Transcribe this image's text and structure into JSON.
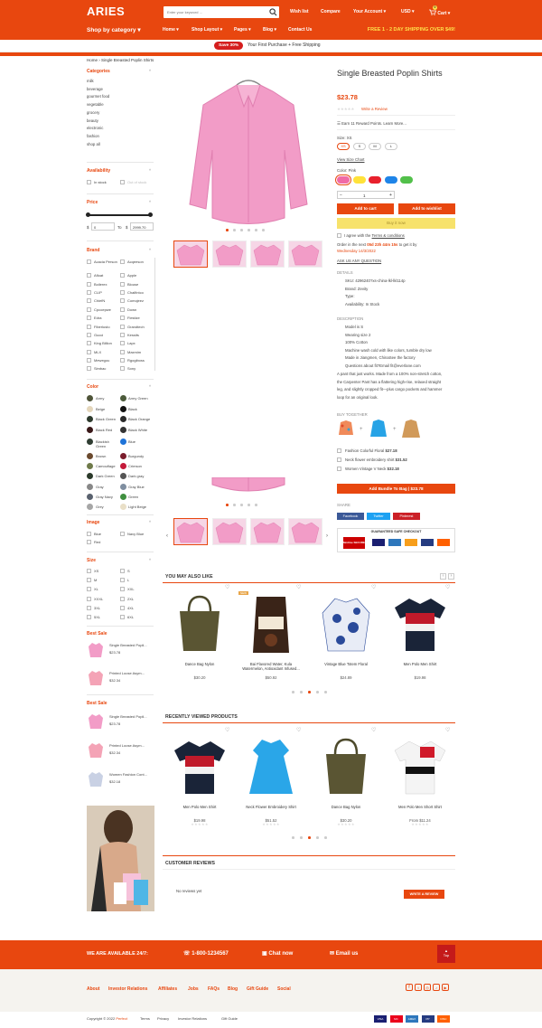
{
  "header": {
    "logo": "ARIES",
    "search_placeholder": "Enter your keyword ...",
    "wishlist": "Wish list",
    "compare": "Compare",
    "account": "Your Account",
    "currency": "USD",
    "cart": "Cart",
    "cart_count": "0",
    "shop_by_category": "Shop by category",
    "nav": [
      "Home",
      "Shop Layout",
      "Pages",
      "Blog",
      "Contact Us"
    ],
    "shipping": "FREE 1 - 2 DAY SHIPPING OVER $49!"
  },
  "promo": {
    "badge": "Save 30%",
    "text": "Your First Purchase + Free Shipping"
  },
  "breadcrumb": {
    "home": "Home",
    "current": "Single Breasted Poplin Shirts"
  },
  "sidebar": {
    "categories_title": "Categories",
    "categories": [
      "milk",
      "beverage",
      "gourmet food",
      "vegetable",
      "grocery",
      "beauty",
      "electronic",
      "fashion",
      "shop all"
    ],
    "availability_title": "Availability",
    "availability": [
      "In stock",
      "Out of stock"
    ],
    "price_title": "Price",
    "price_currency": "$",
    "price_min": "0",
    "price_to": "To",
    "price_max": "2999.70",
    "brand_title": "Brand",
    "brands_left": [
      "Acacia Person",
      "Afloat",
      "Boilerex",
      "CLIP",
      "ChiefN",
      "Cpcoepwe",
      "Edra",
      "Fiberlusto",
      "Gucci",
      "King Billion",
      "MLX",
      "Mewegou",
      "Simbac"
    ],
    "brands_right": [
      "Acqeeson",
      "Apple",
      "Blouse",
      "Chalfintco",
      "Comojeez",
      "Down",
      "Fiestize",
      "Grandtech",
      "Kessits",
      "Lapx",
      "Maxmim",
      "Rgogiboss",
      "Sony"
    ],
    "color_title": "Color",
    "colors_left": [
      "Army",
      "Beige",
      "Black Green",
      "Black Red",
      "Blackish Green",
      "Brown",
      "Camouflage",
      "Dark Green",
      "Gray",
      "Gray Navy",
      "Grey"
    ],
    "colors_right": [
      "Army Green",
      "Black",
      "Black Orange",
      "Black White",
      "Blue",
      "Burgundy",
      "Crimson",
      "Dark gray",
      "Gray Blue",
      "Green",
      "Light Beige"
    ],
    "image_title": "Image",
    "image_opts": [
      "Blue",
      "Navy Blue",
      "Red"
    ],
    "size_title": "Size",
    "sizes_left": [
      "XS",
      "M",
      "XL",
      "XXXL",
      "3XL",
      "5XL"
    ],
    "sizes_right": [
      "S",
      "L",
      "XXL",
      "2XL",
      "4XL",
      "6XL"
    ],
    "best_sale_title": "Best Sale",
    "best_sale": [
      {
        "name": "Single Breasted Popli...",
        "price": "$23.78"
      },
      {
        "name": "Printed Loose Asym...",
        "price": "$32.34"
      }
    ],
    "best_sale2_title": "Best Sale",
    "best_sale2": [
      {
        "name": "Single Breasted Popli...",
        "price": "$23.78"
      },
      {
        "name": "Printed Loose Asym...",
        "price": "$32.34"
      },
      {
        "name": "Women Fashion Cont...",
        "price": "$32.18"
      }
    ]
  },
  "product": {
    "title": "Single Breasted Poplin Shirts",
    "price": "$23.78",
    "write_review": "Write a Review",
    "reward": "Earn 11 Reward Points.",
    "learn_more": "Learn More...",
    "size_label": "Size: XS",
    "sizes": [
      "XS",
      "S",
      "M",
      "L"
    ],
    "size_chart": "View Size Chart",
    "color_label": "Color: Pink",
    "colors_hex": [
      "#f06aa6",
      "#ffe23a",
      "#e8202c",
      "#1e84e8",
      "#52c04a"
    ],
    "qty": "1",
    "add_to_cart": "Add to cart",
    "add_to_wishlist": "Add to wishlist",
    "buy_now": "Buy it now",
    "agree": "I agree with the",
    "terms": "Terms & conditions",
    "order_line1": "Order in the next",
    "order_time": "05d 23h 44m 15s",
    "order_to_get": "to get it by",
    "order_date": "Wednesday 14/3/2022",
    "ask": "ASK US ANY QUESTION",
    "details_title": "DETAILS",
    "details": [
      "SKU: 4296240?xs-china-lkl-lkl114p",
      "Brand: Zevity",
      "Type:",
      "Availability: In Stock"
    ],
    "description_title": "DESCRIPTION",
    "description": [
      "Model is S",
      "Wearing size 2",
      "100% Cotton",
      "Machine wash cold with like colors, tumble dry low",
      "Made in Jiangmen, ChinaSee the factory",
      "Questions about fit?Email fit@everlane.com"
    ],
    "paragraph": [
      "A pant that just works. Made from a 100% non-stretch cotton,",
      "the Carpenter Pant has a flattering high-rise, relaxed straight",
      "leg, and slightly cropped fit—plus cargo pockets and hammer",
      "loop for an original look."
    ],
    "buy_together_title": "BUY TOGETHER",
    "bundle": [
      {
        "name": "Fashion Colorful Floral",
        "price": "$27.18"
      },
      {
        "name": "Neck flower embroidery shirt",
        "price": "$31.52"
      },
      {
        "name": "Women Vintage V Neck",
        "price": "$32.18"
      }
    ],
    "bundle_btn": "Add Bundle To Bag | $23.78",
    "share_title": "SHARE",
    "share": [
      "Facebook",
      "Twitter",
      "Pinterest"
    ],
    "guarantee": "GUARANTEED SAFE CHECKOUT",
    "mcafee": "McAfee SECURE"
  },
  "also_like": {
    "title": "YOU MAY ALSO LIKE",
    "items": [
      {
        "name": "Dance Bag Nylon",
        "price": "$30.20"
      },
      {
        "name": "Bai Flavored Water, Kula Watermelon, Antioxidant Infused...",
        "price": "$50.92",
        "badge": "NEW"
      },
      {
        "name": "Vintage Blue Totem Floral",
        "price": "$24.89"
      },
      {
        "name": "Men Polo Men Shirt",
        "price": "$19.98"
      }
    ]
  },
  "recent": {
    "title": "RECENTLY VIEWED PRODUCTS",
    "items": [
      {
        "name": "Men Polo Men Shirt",
        "price": "$19.98"
      },
      {
        "name": "Neck Flower Embroidery Shirt",
        "price": "$51.52"
      },
      {
        "name": "Dance Bag Nylon",
        "price": "$30.20"
      },
      {
        "name": "Men Polo Men Short Shirt",
        "price": "From $11.24"
      }
    ]
  },
  "reviews": {
    "title": "CUSTOMER REVIEWS",
    "none": "No reviews yet",
    "write": "WRITE A REVIEW"
  },
  "footer": {
    "available": "WE ARE AVAILABLE 24/7:",
    "phone": "1-800-1234567",
    "chat": "Chat now",
    "email": "Email us",
    "top": "Top",
    "links": [
      "About",
      "Investor Relations",
      "Affiliates",
      "Jobs",
      "FAQs",
      "Blog",
      "Gift Guide",
      "Social"
    ],
    "copyright": "Copyright © 2022",
    "brand": "Perfect",
    "bottom_links": [
      "Terms",
      "Privacy",
      "Investor Relations",
      "Gift Guide"
    ],
    "payments": [
      "VISA",
      "MC",
      "AMEX",
      "PP",
      "DISC"
    ]
  },
  "colors": {
    "accent": "#e8470f",
    "yellow": "#ffe14a",
    "buy_now": "#f7e26b"
  }
}
